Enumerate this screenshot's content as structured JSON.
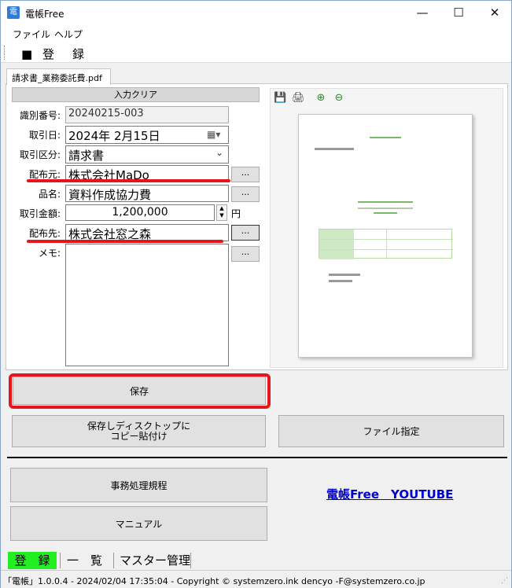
{
  "window": {
    "title": "電帳Free",
    "app_icon": "電"
  },
  "menu": {
    "items": [
      "ファイル",
      "ヘルプ"
    ]
  },
  "toolbar": {
    "register_label": "■ 登　録"
  },
  "tab": {
    "label": "請求書_業務委託費.pdf"
  },
  "form": {
    "clear_button": "入力クリア",
    "id_label": "識別番号:",
    "id_value": "20240215-003",
    "date_label": "取引日:",
    "date_value": "2024年  2月15日",
    "category_label": "取引区分:",
    "category_value": "請求書",
    "from_label": "配布元:",
    "from_value": "株式会社MaDo",
    "item_label": "品名:",
    "item_value": "資料作成協力費",
    "amount_label": "取引金額:",
    "amount_value": "1,200,000",
    "amount_unit": "円",
    "to_label": "配布先:",
    "to_value": "株式会社窓之森",
    "memo_label": "メモ:",
    "memo_value": "",
    "browse_label": "..."
  },
  "buttons": {
    "save": "保存",
    "save_copy_line1": "保存しディスクトップに",
    "save_copy_line2": "コピー貼付け",
    "file_select": "ファイル指定",
    "office_rules": "事務処理規程",
    "manual": "マニュアル",
    "youtube": "電帳Free　YOUTUBE"
  },
  "bottom_tabs": [
    "登　録",
    "一　覧",
    "マスター管理"
  ],
  "status": "「電帳」1.0.0.4 - 2024/02/04 17:35:04 - Copyright ©  systemzero.ink dencyo -F@systemzero.co.jp",
  "colors": {
    "highlight_red": "#e8141c",
    "active_tab_green": "#22ee22",
    "link_blue": "#0000cc"
  }
}
